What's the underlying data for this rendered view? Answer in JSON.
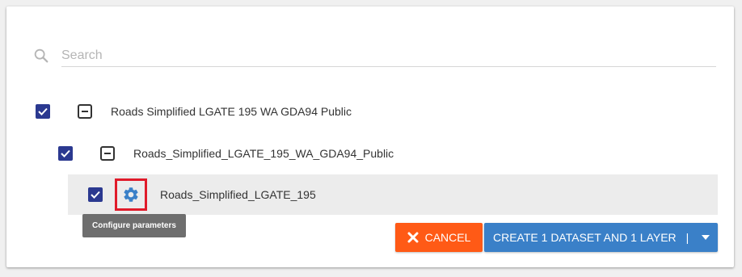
{
  "search": {
    "placeholder": "Search",
    "value": ""
  },
  "tree": {
    "level1": {
      "label": "Roads Simplified LGATE 195 WA GDA94 Public",
      "checked": true
    },
    "level2": {
      "label": "Roads_Simplified_LGATE_195_WA_GDA94_Public",
      "checked": true
    },
    "level3": {
      "label": "Roads_Simplified_LGATE_195",
      "checked": true
    }
  },
  "tooltip": {
    "text": "Configure parameters"
  },
  "buttons": {
    "cancel": "CANCEL",
    "create": "CREATE 1 DATASET AND 1 LAYER",
    "create_separator": "|"
  },
  "colors": {
    "checkbox": "#2b3990",
    "cancel": "#ff5a16",
    "create": "#3a80c8",
    "gear": "#3a80c8",
    "highlight_border": "#e01b2a",
    "selected_row": "#ececec"
  },
  "icons": {
    "search": "search-icon",
    "check": "check-icon",
    "collapse": "minus-square-icon",
    "gear": "gear-icon",
    "close": "close-icon",
    "dropdown": "caret-down-icon"
  }
}
